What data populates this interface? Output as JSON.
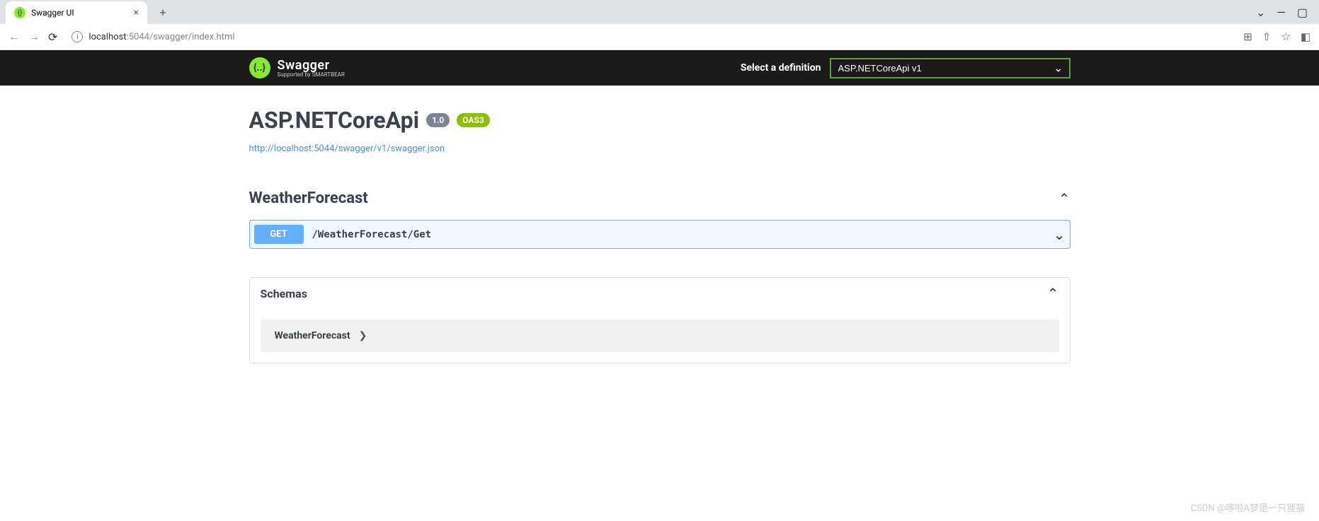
{
  "browser": {
    "tab_title": "Swagger UI",
    "url_host": "localhost",
    "url_port": ":5044",
    "url_path": "/swagger/index.html"
  },
  "topbar": {
    "logo_text": "Swagger",
    "logo_sub": "Supported by SMARTBEAR",
    "definition_label": "Select a definition",
    "definition_selected": "ASP.NETCoreApi v1"
  },
  "api": {
    "title": "ASP.NETCoreApi",
    "version": "1.0",
    "oas": "OAS3",
    "spec_link": "http://localhost:5044/swagger/v1/swagger.json"
  },
  "tag": {
    "name": "WeatherForecast",
    "operations": [
      {
        "method": "GET",
        "path": "/WeatherForecast/Get"
      }
    ]
  },
  "schemas": {
    "title": "Schemas",
    "items": [
      {
        "name": "WeatherForecast"
      }
    ]
  },
  "watermark": "CSDN @哆啦A梦是一只狸猫"
}
